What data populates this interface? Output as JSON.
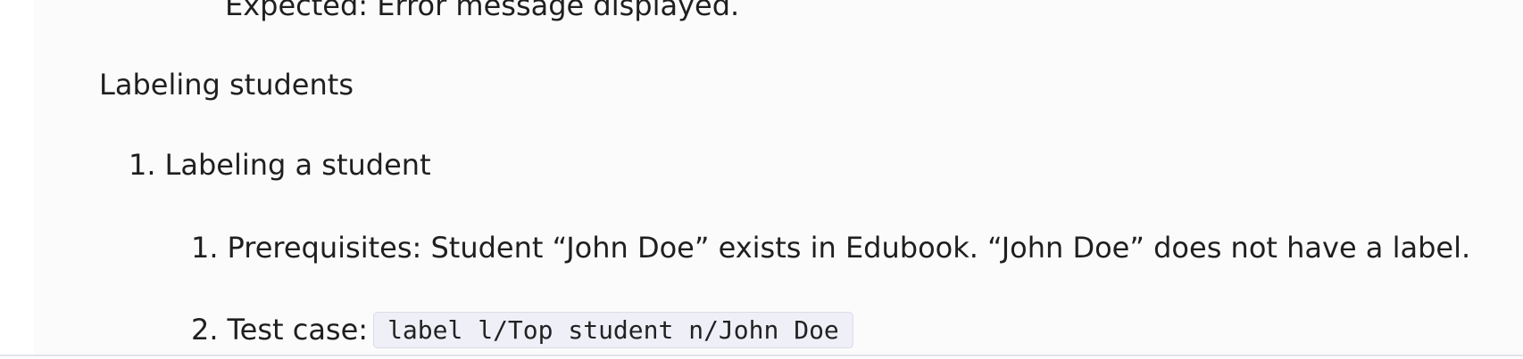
{
  "content": {
    "expected_line": "Expected: Error message displayed.",
    "section_heading": "Labeling students",
    "list_item_1": {
      "number": "1.",
      "text": "Labeling a student"
    },
    "sub_items": [
      {
        "number": "1.",
        "text": "Prerequisites: Student “John Doe” exists in Edubook. “John Doe” does not have a label."
      },
      {
        "number": "2.",
        "label": "Test case:",
        "code": "label l/Top student n/John Doe"
      }
    ]
  }
}
